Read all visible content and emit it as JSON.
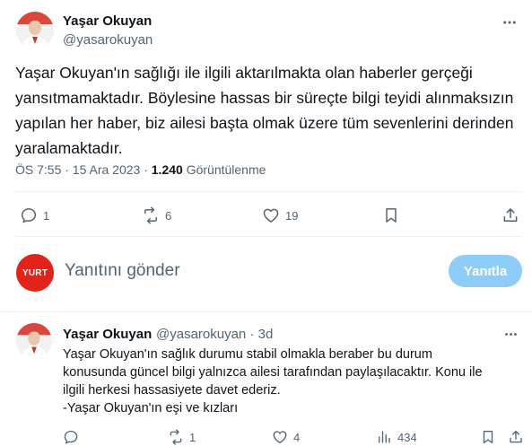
{
  "main_tweet": {
    "author_name": "Yaşar Okuyan",
    "author_handle": "@yasarokuyan",
    "text": "Yaşar Okuyan'ın sağlığı ile ilgili aktarılmakta olan haberler gerçeği yansıtmamaktadır. Böylesine hassas bir süreçte bilgi teyidi alınmaksızın yapılan her haber, biz ailesi başta olmak üzere tüm sevenlerini derinden yaralamaktadır.",
    "timestamp": "ÖS 7:55 · 15 Ara 2023 ·",
    "views_count": "1.240",
    "views_label": "Görüntülenme",
    "stats": {
      "replies": "1",
      "retweets": "6",
      "likes": "19"
    }
  },
  "reply_compose": {
    "avatar_label": "YURT",
    "placeholder": "Yanıtını gönder",
    "button_label": "Yanıtla"
  },
  "reply_tweet": {
    "author_name": "Yaşar Okuyan",
    "author_handle": "@yasarokuyan · 3d",
    "lines": [
      "Yaşar Okuyan'ın sağlık durumu stabil olmakla beraber bu durum",
      "konusunda güncel bilgi yalnızca ailesi tarafından paylaşılacaktır. Konu ile",
      "ilgili herkesi hassasiyete davet ederiz.",
      "-Yaşar Okuyan'ın eşi ve kızları"
    ],
    "stats": {
      "replies": "",
      "retweets": "1",
      "likes": "4",
      "views": "434"
    }
  },
  "colors": {
    "accent": "#1d9bf0",
    "button_disabled": "#8ecdf8",
    "secondary_text": "#536471",
    "brand_red": "#e2231a"
  },
  "icons": [
    "more-icon",
    "reply-icon",
    "retweet-icon",
    "like-icon",
    "bookmark-icon",
    "share-icon",
    "views-icon"
  ]
}
